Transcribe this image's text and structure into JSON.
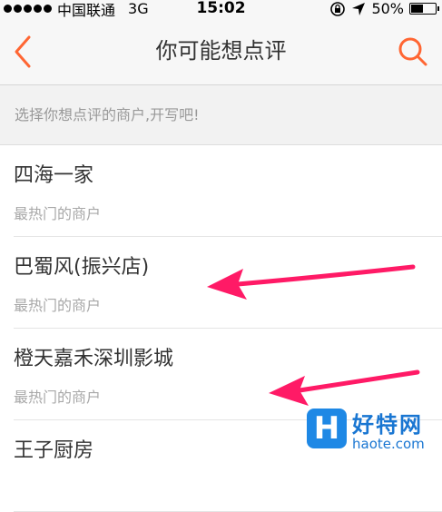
{
  "status_bar": {
    "carrier": "中国联通",
    "network": "3G",
    "time": "15:02",
    "battery": "50%",
    "battery_level": 0.5
  },
  "nav": {
    "title": "你可能想点评",
    "back_icon": "chevron-left-icon",
    "search_icon": "search-icon",
    "accent_color": "#ff6633"
  },
  "hint": "选择你想点评的商户,开写吧!",
  "items": [
    {
      "name": "四海一家",
      "subtitle": "最热门的商户"
    },
    {
      "name": "巴蜀风(振兴店)",
      "subtitle": "最热门的商户"
    },
    {
      "name": "橙天嘉禾深圳影城",
      "subtitle": "最热门的商户"
    },
    {
      "name": "王子厨房",
      "subtitle": ""
    }
  ],
  "annotation_color": "#ff1a66",
  "watermark": {
    "logo_letter": "H",
    "name": "好特网",
    "url": "haote.com"
  }
}
